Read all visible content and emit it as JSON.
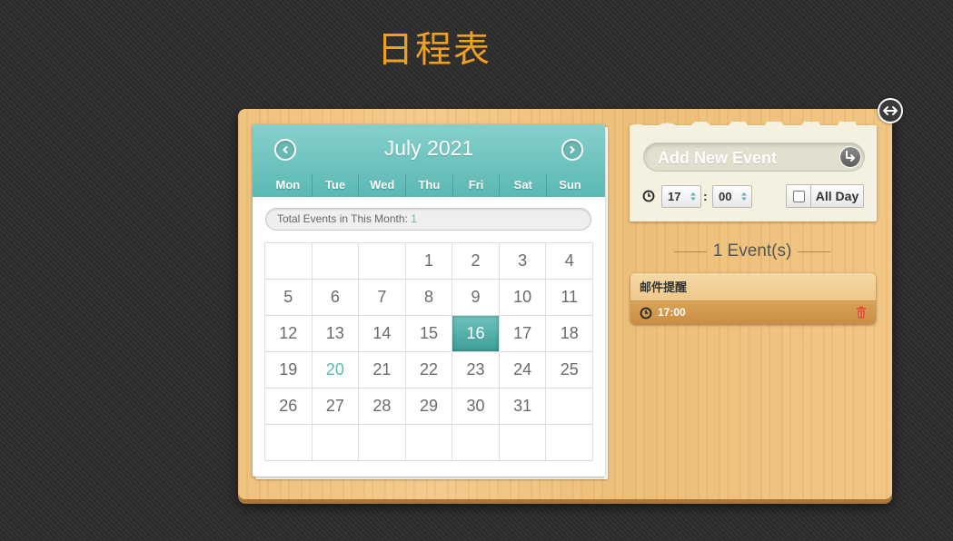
{
  "page": {
    "title": "日程表"
  },
  "calendar": {
    "month_title": "July 2021",
    "weekdays": [
      "Mon",
      "Tue",
      "Wed",
      "Thu",
      "Fri",
      "Sat",
      "Sun"
    ],
    "total_label": "Total Events in This Month: ",
    "total_count": "1",
    "weeks": [
      [
        "",
        "",
        "",
        "1",
        "2",
        "3",
        "4"
      ],
      [
        "5",
        "6",
        "7",
        "8",
        "9",
        "10",
        "11"
      ],
      [
        "12",
        "13",
        "14",
        "15",
        "16",
        "17",
        "18"
      ],
      [
        "19",
        "20",
        "21",
        "22",
        "23",
        "24",
        "25"
      ],
      [
        "26",
        "27",
        "28",
        "29",
        "30",
        "31",
        ""
      ],
      [
        "",
        "",
        "",
        "",
        "",
        "",
        ""
      ]
    ],
    "selected_day": "16",
    "today_day": "20"
  },
  "add_event": {
    "placeholder": "Add New Event",
    "hour": "17",
    "minute": "00",
    "time_separator": ":",
    "all_day_label": "All Day",
    "all_day_checked": false
  },
  "events": {
    "count_label": "1 Event(s)",
    "items": [
      {
        "title": "邮件提醒",
        "time": "17:00"
      }
    ]
  },
  "icons": {
    "prev": "chevron-left-icon",
    "next": "chevron-right-icon",
    "resize": "resize-horizontal-icon",
    "add": "enter-icon",
    "clock": "clock-icon",
    "delete": "trash-icon"
  },
  "colors": {
    "accent": "#5bb8b3",
    "title": "#f0a020",
    "delete": "#e84a3c"
  }
}
